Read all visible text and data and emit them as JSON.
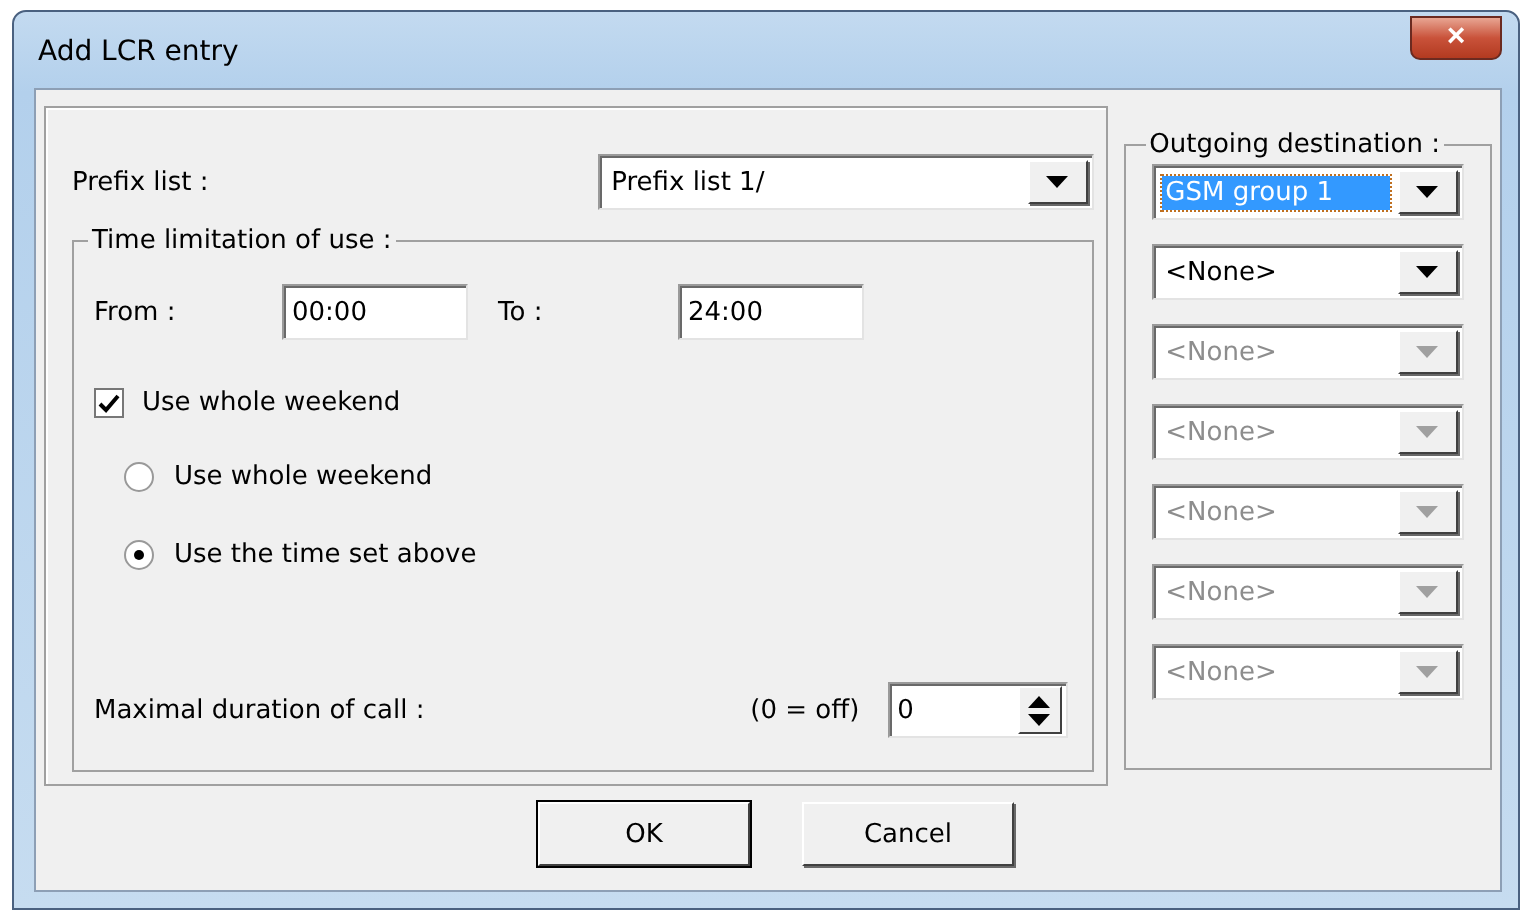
{
  "window": {
    "title": "Add LCR entry",
    "close": "×"
  },
  "prefix_list": {
    "label": "Prefix list :",
    "value": "Prefix list 1/"
  },
  "time_limitation": {
    "title": "Time limitation of use :",
    "from_label": "From :",
    "from_value": "00:00",
    "to_label": "To :",
    "to_value": "24:00",
    "weekend_checkbox": {
      "label": "Use whole weekend",
      "checked": true
    },
    "radios": [
      {
        "label": "Use whole weekend",
        "selected": false
      },
      {
        "label": "Use the time set above",
        "selected": true
      }
    ],
    "max_duration_label": "Maximal duration of call :",
    "off_hint": "(0 = off)",
    "max_duration_value": "0"
  },
  "outgoing_destination": {
    "title": "Outgoing destination :",
    "combos": [
      {
        "value": "GSM group 1",
        "focused": true,
        "disabled": false
      },
      {
        "value": "<None>",
        "focused": false,
        "disabled": false
      },
      {
        "value": "<None>",
        "focused": false,
        "disabled": true
      },
      {
        "value": "<None>",
        "focused": false,
        "disabled": true
      },
      {
        "value": "<None>",
        "focused": false,
        "disabled": true
      },
      {
        "value": "<None>",
        "focused": false,
        "disabled": true
      },
      {
        "value": "<None>",
        "focused": false,
        "disabled": true
      }
    ]
  },
  "buttons": [
    "OK",
    "Cancel"
  ]
}
